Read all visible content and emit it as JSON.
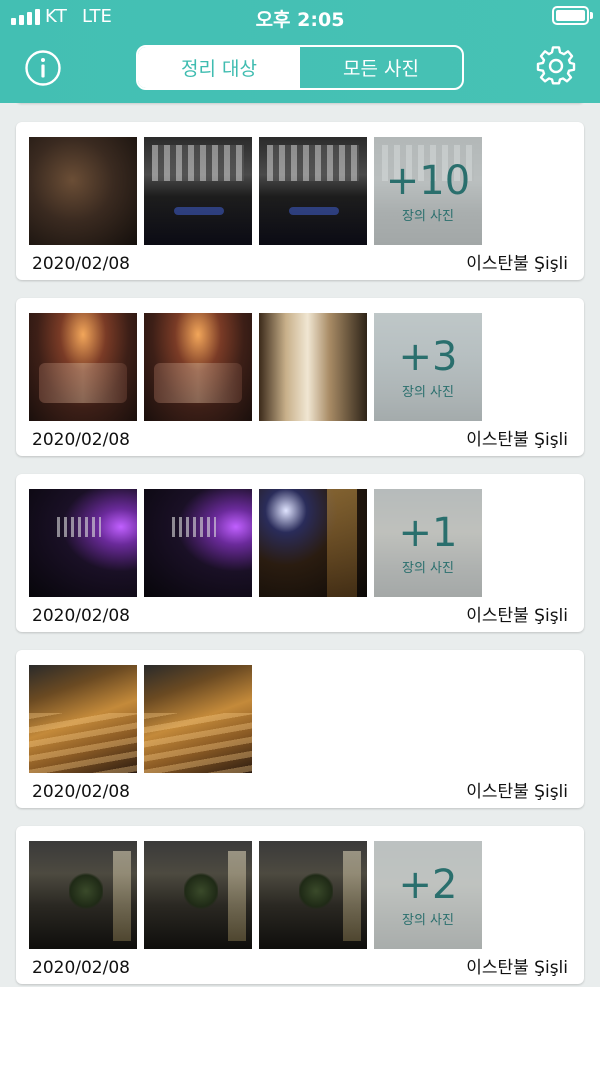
{
  "status_bar": {
    "carrier": "KT",
    "network": "LTE",
    "time": "오후 2:05"
  },
  "toolbar": {
    "tabs": [
      {
        "label": "정리 대상",
        "active": true
      },
      {
        "label": "모든 사진",
        "active": false
      }
    ],
    "info_icon": "info-circle-icon",
    "settings_icon": "gear-icon"
  },
  "colors": {
    "accent": "#43bfb3",
    "more_text": "#2a6f6d",
    "background": "#e9eded"
  },
  "groups": [
    {
      "date": "2020/02/08",
      "location": "이스탄불 Şişli",
      "more_count": "+10",
      "more_unit": "장의 사진"
    },
    {
      "date": "2020/02/08",
      "location": "이스탄불 Şişli",
      "more_count": "+3",
      "more_unit": "장의 사진"
    },
    {
      "date": "2020/02/08",
      "location": "이스탄불 Şişli",
      "more_count": "+1",
      "more_unit": "장의 사진"
    },
    {
      "date": "2020/02/08",
      "location": "이스탄불 Şişli"
    },
    {
      "date": "2020/02/08",
      "location": "이스탄불 Şişli",
      "more_count": "+2",
      "more_unit": "장의 사진"
    }
  ]
}
